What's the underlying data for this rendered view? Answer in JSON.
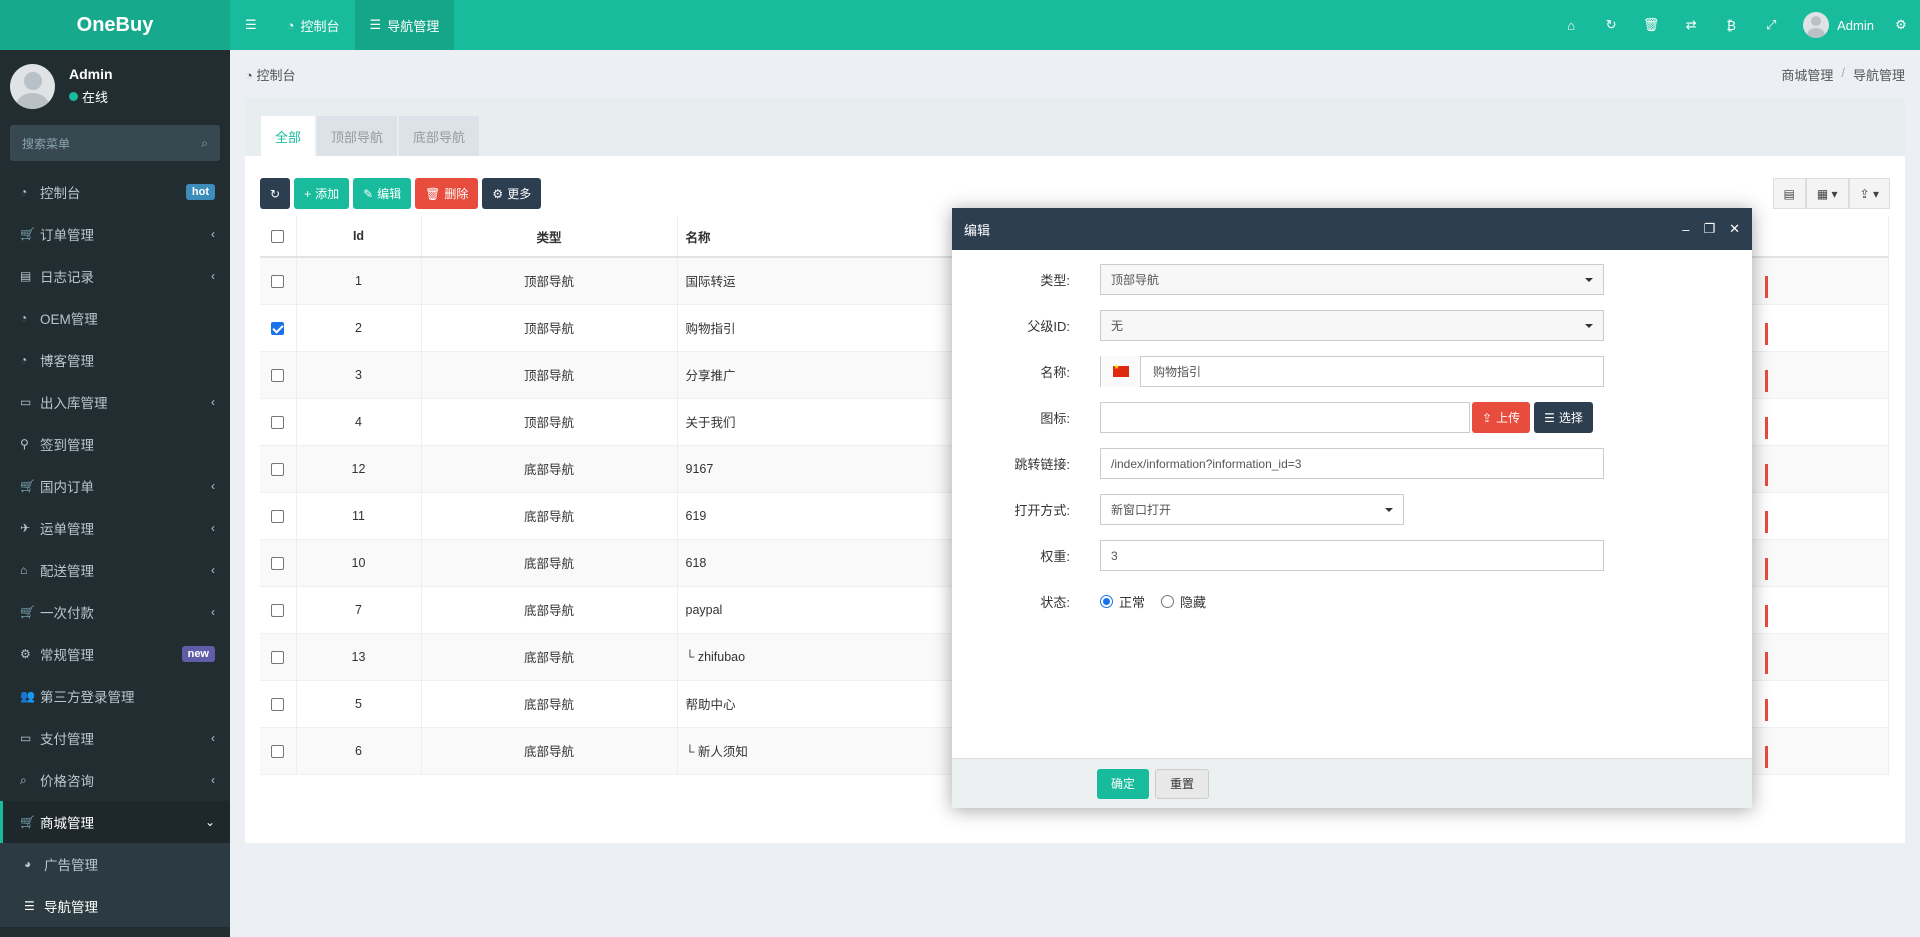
{
  "app": {
    "logo": "OneBuy"
  },
  "topnav": {
    "menu_icon": "bars-icon",
    "tabs": [
      {
        "icon": "dashboard-icon",
        "label": "控制台"
      },
      {
        "icon": "list-icon",
        "label": "导航管理"
      }
    ]
  },
  "topright": {
    "icons": [
      "home-icon",
      "refresh-icon",
      "trash-icon",
      "translate-icon",
      "bitcoin-icon",
      "fullscreen-icon"
    ],
    "user": "Admin",
    "settings_icon": "gears-icon"
  },
  "sidebar": {
    "user": {
      "name": "Admin",
      "status": "在线"
    },
    "search_placeholder": "搜索菜单",
    "items": [
      {
        "label": "控制台",
        "icon": "dashboard-icon",
        "badge": "hot",
        "badge_color": "#3c8dbc"
      },
      {
        "label": "订单管理",
        "icon": "cart-icon",
        "chevron": "‹"
      },
      {
        "label": "日志记录",
        "icon": "book-icon",
        "chevron": "‹"
      },
      {
        "label": "OEM管理",
        "icon": "dashboard-icon"
      },
      {
        "label": "博客管理",
        "icon": "dashboard-icon"
      },
      {
        "label": "出入库管理",
        "icon": "inbox-icon",
        "chevron": "‹"
      },
      {
        "label": "签到管理",
        "icon": "map-marker-icon"
      },
      {
        "label": "国内订单",
        "icon": "cart-icon",
        "chevron": "‹"
      },
      {
        "label": "运单管理",
        "icon": "plane-icon",
        "chevron": "‹"
      },
      {
        "label": "配送管理",
        "icon": "bank-icon",
        "chevron": "‹"
      },
      {
        "label": "一次付款",
        "icon": "cart-plus-icon",
        "chevron": "‹"
      },
      {
        "label": "常规管理",
        "icon": "cogs-icon",
        "badge": "new",
        "badge_color": "#605ca8"
      },
      {
        "label": "第三方登录管理",
        "icon": "users-icon"
      },
      {
        "label": "支付管理",
        "icon": "credit-card-icon",
        "chevron": "‹"
      },
      {
        "label": "价格咨询",
        "icon": "search-icon",
        "chevron": "‹"
      },
      {
        "label": "商城管理",
        "icon": "cart-icon",
        "chevron": "⌄"
      }
    ],
    "subitems": [
      {
        "label": "广告管理",
        "icon": "pie-chart-icon"
      },
      {
        "label": "导航管理",
        "icon": "list-icon"
      }
    ]
  },
  "breadcrumb": {
    "home": "控制台",
    "path": [
      "商城管理",
      "导航管理"
    ],
    "sep": "/"
  },
  "tabs": [
    "全部",
    "顶部导航",
    "底部导航"
  ],
  "toolbar": {
    "refresh_icon": "refresh-icon",
    "add": "添加",
    "edit": "编辑",
    "delete": "删除",
    "more": "更多"
  },
  "table": {
    "headers": {
      "id": "Id",
      "type": "类型",
      "name": "名称"
    },
    "rows": [
      {
        "id": "1",
        "type": "顶部导航",
        "name": "国际转运",
        "checked": false
      },
      {
        "id": "2",
        "type": "顶部导航",
        "name": "购物指引",
        "checked": true
      },
      {
        "id": "3",
        "type": "顶部导航",
        "name": "分享推广",
        "checked": false
      },
      {
        "id": "4",
        "type": "顶部导航",
        "name": "关于我们",
        "checked": false
      },
      {
        "id": "12",
        "type": "底部导航",
        "name": "9167",
        "checked": false
      },
      {
        "id": "11",
        "type": "底部导航",
        "name": "619",
        "checked": false
      },
      {
        "id": "10",
        "type": "底部导航",
        "name": "618",
        "checked": false
      },
      {
        "id": "7",
        "type": "底部导航",
        "name": "paypal",
        "checked": false
      },
      {
        "id": "13",
        "type": "底部导航",
        "name": "└ zhifubao",
        "checked": false
      },
      {
        "id": "5",
        "type": "底部导航",
        "name": "帮助中心",
        "checked": false
      },
      {
        "id": "6",
        "type": "底部导航",
        "name": "└ 新人须知",
        "checked": false
      }
    ]
  },
  "modal": {
    "title": "编辑",
    "fields": {
      "type": {
        "label": "类型:",
        "value": "顶部导航"
      },
      "parent": {
        "label": "父级ID:",
        "value": "无"
      },
      "name": {
        "label": "名称:",
        "value": "购物指引"
      },
      "icon": {
        "label": "图标:",
        "value": "",
        "upload": "上传",
        "choose": "选择"
      },
      "link": {
        "label": "跳转链接:",
        "value": "/index/information?information_id=3"
      },
      "open": {
        "label": "打开方式:",
        "value": "新窗口打开"
      },
      "weight": {
        "label": "权重:",
        "value": "3"
      },
      "status": {
        "label": "状态:",
        "options": [
          "正常",
          "隐藏"
        ],
        "selected": "正常"
      }
    },
    "confirm": "确定",
    "reset": "重置"
  },
  "colors": {
    "primary": "#18bc9c",
    "dark": "#2c3e50",
    "danger": "#e74c3c",
    "sidebar": "#222d32"
  }
}
